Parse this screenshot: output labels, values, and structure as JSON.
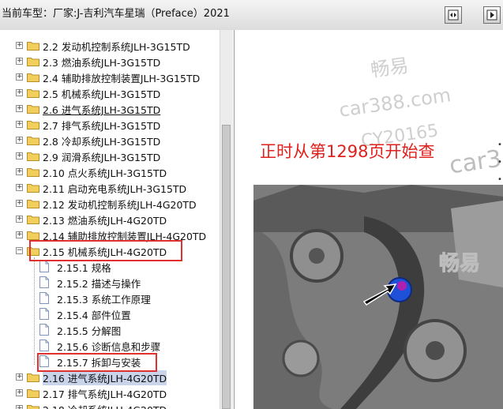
{
  "header": {
    "title": "当前车型：厂家:J-吉利汽车星瑞（Preface）2021",
    "buttons": [
      {
        "icon": "panel-toggle-icon"
      },
      {
        "icon": "next-page-icon"
      }
    ]
  },
  "tree": {
    "items": [
      {
        "label": "2.2 发动机控制系统JLH-3G15TD",
        "level": 1
      },
      {
        "label": "2.3 燃油系统JLH-3G15TD",
        "level": 1
      },
      {
        "label": "2.4 辅助排放控制装置JLH-3G15TD",
        "level": 1
      },
      {
        "label": "2.5 机械系统JLH-3G15TD",
        "level": 1
      },
      {
        "label": "2.6 进气系统JLH-3G15TD",
        "level": 1
      },
      {
        "label": "2.7 排气系统JLH-3G15TD",
        "level": 1
      },
      {
        "label": "2.8 冷却系统JLH-3G15TD",
        "level": 1
      },
      {
        "label": "2.9 润滑系统JLH-3G15TD",
        "level": 1
      },
      {
        "label": "2.10 点火系统JLH-3G15TD",
        "level": 1
      },
      {
        "label": "2.11 启动充电系统JLH-3G15TD",
        "level": 1
      },
      {
        "label": "2.12 发动机控制系统JLH-4G20TD",
        "level": 1
      },
      {
        "label": "2.13 燃油系统JLH-4G20TD",
        "level": 1
      },
      {
        "label": "2.14 辅助排放控制装置JLH-4G20TD",
        "level": 1
      },
      {
        "label": "2.15 机械系统JLH-4G20TD",
        "level": 1,
        "expanded": true
      },
      {
        "label": "2.15.1 规格",
        "level": 2
      },
      {
        "label": "2.15.2 描述与操作",
        "level": 2
      },
      {
        "label": "2.15.3 系统工作原理",
        "level": 2
      },
      {
        "label": "2.15.4 部件位置",
        "level": 2
      },
      {
        "label": "2.15.5 分解图",
        "level": 2
      },
      {
        "label": "2.15.6 诊断信息和步骤",
        "level": 2
      },
      {
        "label": "2.15.7 拆卸与安装",
        "level": 2
      },
      {
        "label": "2.16 进气系统JLH-4G20TD",
        "level": 1,
        "selected": true
      },
      {
        "label": "2.17 排气系统JLH-4G20TD",
        "level": 1
      },
      {
        "label": "2.18 冷却系统JLH-4G20TD",
        "level": 1
      }
    ]
  },
  "content": {
    "watermark": [
      "畅易",
      "car388.com",
      "CY20165",
      "car3",
      "畅易"
    ],
    "notice": "正时从第1298页开始查"
  }
}
